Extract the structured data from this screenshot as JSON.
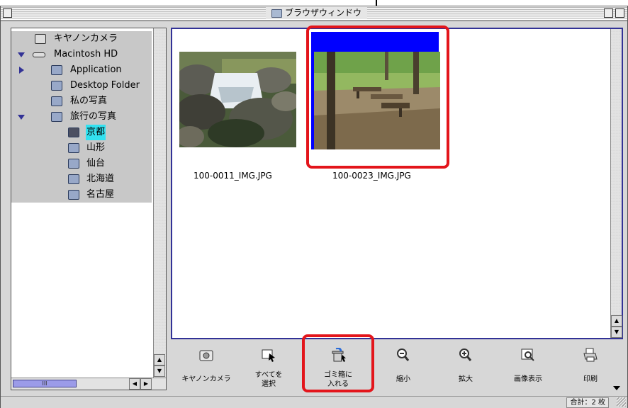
{
  "window": {
    "title": "ブラウザウィンドウ"
  },
  "tree": [
    {
      "label": "キヤノンカメラ",
      "icon": "camera-icon",
      "expander": "none"
    },
    {
      "label": "Macintosh HD",
      "icon": "hard-disk-icon",
      "expander": "expanded"
    },
    {
      "label": "Application",
      "icon": "folder-icon",
      "expander": "collapsed"
    },
    {
      "label": "Desktop Folder",
      "icon": "folder-icon",
      "expander": "none"
    },
    {
      "label": "私の写真",
      "icon": "folder-icon",
      "expander": "none"
    },
    {
      "label": "旅行の写真",
      "icon": "folder-icon",
      "expander": "expanded"
    },
    {
      "label": "京都",
      "icon": "open-folder-icon",
      "expander": "none",
      "selected": true
    },
    {
      "label": "山形",
      "icon": "folder-icon",
      "expander": "none"
    },
    {
      "label": "仙台",
      "icon": "folder-icon",
      "expander": "none"
    },
    {
      "label": "北海道",
      "icon": "folder-icon",
      "expander": "none"
    },
    {
      "label": "名古屋",
      "icon": "folder-icon",
      "expander": "none"
    }
  ],
  "thumbnails": [
    {
      "filename": "100-0011_IMG.JPG",
      "selected": false
    },
    {
      "filename": "100-0023_IMG.JPG",
      "selected": true
    }
  ],
  "toolbar": [
    {
      "label": "キヤノンカメラ",
      "icon": "camera-icon"
    },
    {
      "label": "すべてを\n選択",
      "icon": "select-all-icon"
    },
    {
      "label": "ゴミ箱に\n入れる",
      "icon": "trash-icon"
    },
    {
      "label": "縮小",
      "icon": "zoom-out-icon"
    },
    {
      "label": "拡大",
      "icon": "zoom-in-icon"
    },
    {
      "label": "画像表示",
      "icon": "view-image-icon"
    },
    {
      "label": "印刷",
      "icon": "print-icon"
    }
  ],
  "status": {
    "count": "合計：2 枚"
  },
  "colors": {
    "selection_blue": "#0000ff",
    "callout_red": "#e3151b",
    "tree_highlight": "#33e1f0"
  }
}
